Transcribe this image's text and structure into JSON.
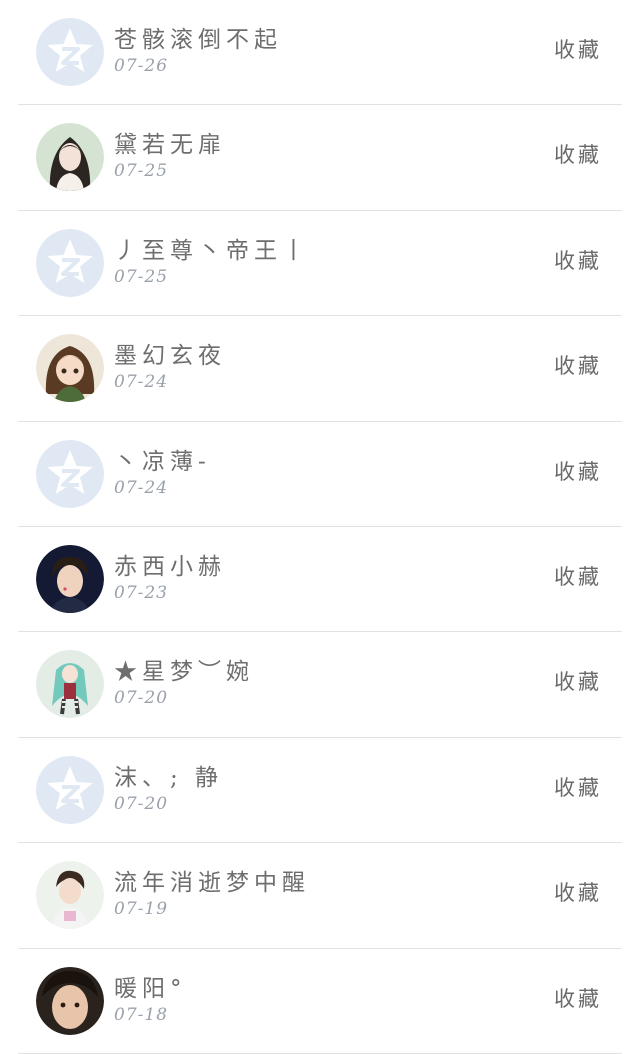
{
  "favorites": {
    "action_label": "收藏",
    "items": [
      {
        "name": "苍骸滚倒不起",
        "date": "07-26",
        "avatar": "qzone-default"
      },
      {
        "name": "黛若无扉",
        "date": "07-25",
        "avatar": "girl-portrait"
      },
      {
        "name": "丿至尊丶帝王丨",
        "date": "07-25",
        "avatar": "qzone-default"
      },
      {
        "name": "墨幻玄夜",
        "date": "07-24",
        "avatar": "anime-girl"
      },
      {
        "name": "丶凉薄-",
        "date": "07-24",
        "avatar": "qzone-default"
      },
      {
        "name": "赤西小赫",
        "date": "07-23",
        "avatar": "young-man-dark"
      },
      {
        "name": "★星梦︶婉",
        "date": "07-20",
        "avatar": "anime-teal-hair"
      },
      {
        "name": "沫、; 静",
        "date": "07-20",
        "avatar": "qzone-default"
      },
      {
        "name": "流年消逝梦中醒",
        "date": "07-19",
        "avatar": "boy-light"
      },
      {
        "name": "暖阳°",
        "date": "07-18",
        "avatar": "boy-closeup"
      }
    ]
  },
  "colors": {
    "default_avatar_bg": "#dfe8f3",
    "text_main": "#6e6e6e",
    "text_date": "#9aa1aa",
    "divider": "#e2e2e2"
  }
}
